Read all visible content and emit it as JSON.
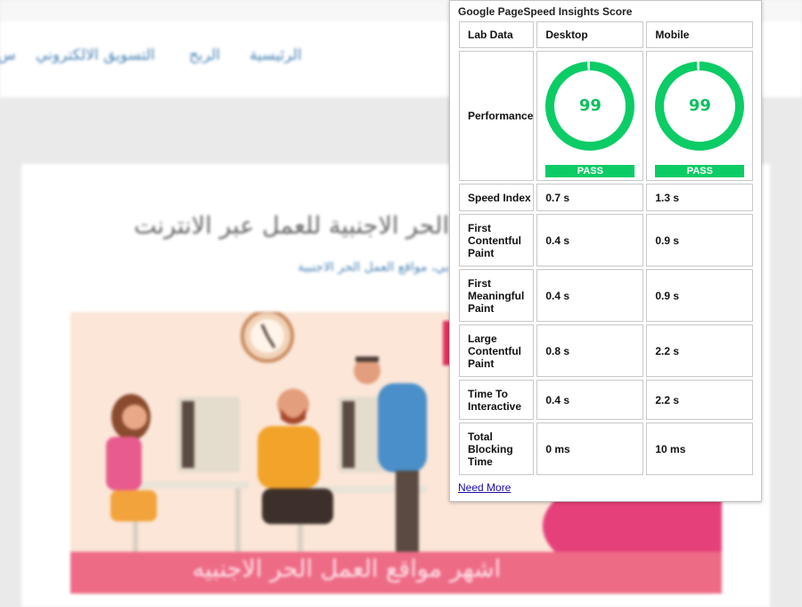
{
  "background_site": {
    "nav": [
      "الرئيسية",
      "الربح",
      "التسويق الالكتروني",
      "س"
    ],
    "post_title": "الحر الاجنبية للعمل عبر الانترنت",
    "post_categories": "بي، مواقع العمل الحر الاجنبية",
    "hero_banner_text": "اشهر مواقع العمل الحر الاجنبيه"
  },
  "pagespeed": {
    "title": "Google PageSpeed Insights Score",
    "header": {
      "label": "Lab Data",
      "desktop": "Desktop",
      "mobile": "Mobile"
    },
    "performance": {
      "label": "Performance",
      "desktop_score": "99",
      "mobile_score": "99",
      "desktop_status": "PASS",
      "mobile_status": "PASS",
      "desktop_fraction": 0.99,
      "mobile_fraction": 0.99
    },
    "metrics": [
      {
        "label": "Speed Index",
        "desktop": "0.7 s",
        "mobile": "1.3 s"
      },
      {
        "label": "First Contentful Paint",
        "desktop": "0.4 s",
        "mobile": "0.9 s"
      },
      {
        "label": "First Meaningful Paint",
        "desktop": "0.4 s",
        "mobile": "0.9 s"
      },
      {
        "label": "Large Contentful Paint",
        "desktop": "0.8 s",
        "mobile": "2.2 s"
      },
      {
        "label": "Time To Interactive",
        "desktop": "0.4 s",
        "mobile": "2.2 s"
      },
      {
        "label": "Total Blocking Time",
        "desktop": "0 ms",
        "mobile": "10 ms"
      }
    ],
    "link": "Need More",
    "colors": {
      "pass": "#0ccc66",
      "score_text": "#0cbf5e",
      "link": "#1a0dab"
    }
  }
}
